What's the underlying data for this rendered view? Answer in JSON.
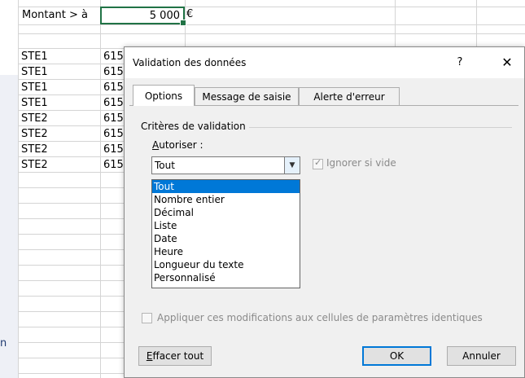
{
  "sheet": {
    "header_label": "Montant > à",
    "amount_value": "5 000",
    "currency": "€",
    "cut_off_text": "n",
    "rows": [
      {
        "col_a": "STE1",
        "col_b": "615"
      },
      {
        "col_a": "STE1",
        "col_b": "615"
      },
      {
        "col_a": "STE1",
        "col_b": "615"
      },
      {
        "col_a": "STE1",
        "col_b": "615"
      },
      {
        "col_a": "STE2",
        "col_b": "615"
      },
      {
        "col_a": "STE2",
        "col_b": "615"
      },
      {
        "col_a": "STE2",
        "col_b": "615"
      },
      {
        "col_a": "STE2",
        "col_b": "615"
      }
    ]
  },
  "dialog": {
    "title": "Validation des données",
    "help_glyph": "?",
    "close_glyph": "✕",
    "tabs": [
      {
        "label": "Options"
      },
      {
        "label": "Message de saisie"
      },
      {
        "label": "Alerte d'erreur"
      }
    ],
    "criteria_group": "Critères de validation",
    "allow_label_underlined": "A",
    "allow_label_rest": "utoriser :",
    "allow_selected": "Tout",
    "allow_options": [
      "Tout",
      "Nombre entier",
      "Décimal",
      "Liste",
      "Date",
      "Heure",
      "Longueur du texte",
      "Personnalisé"
    ],
    "ignore_blank_label": "Ignorer si vide",
    "apply_all_label": "Appliquer ces modifications aux cellules de paramètres identiques",
    "buttons": {
      "clear_underlined": "E",
      "clear_rest": "ffacer tout",
      "ok": "OK",
      "cancel": "Annuler"
    }
  },
  "icons": {
    "dropdown": "chevron-down-icon",
    "check": "check-icon",
    "close": "close-icon",
    "help": "help-icon"
  },
  "colors": {
    "selection": "#0078d7",
    "active_cell_border": "#217346",
    "dialog_bg": "#f0f0f0"
  }
}
